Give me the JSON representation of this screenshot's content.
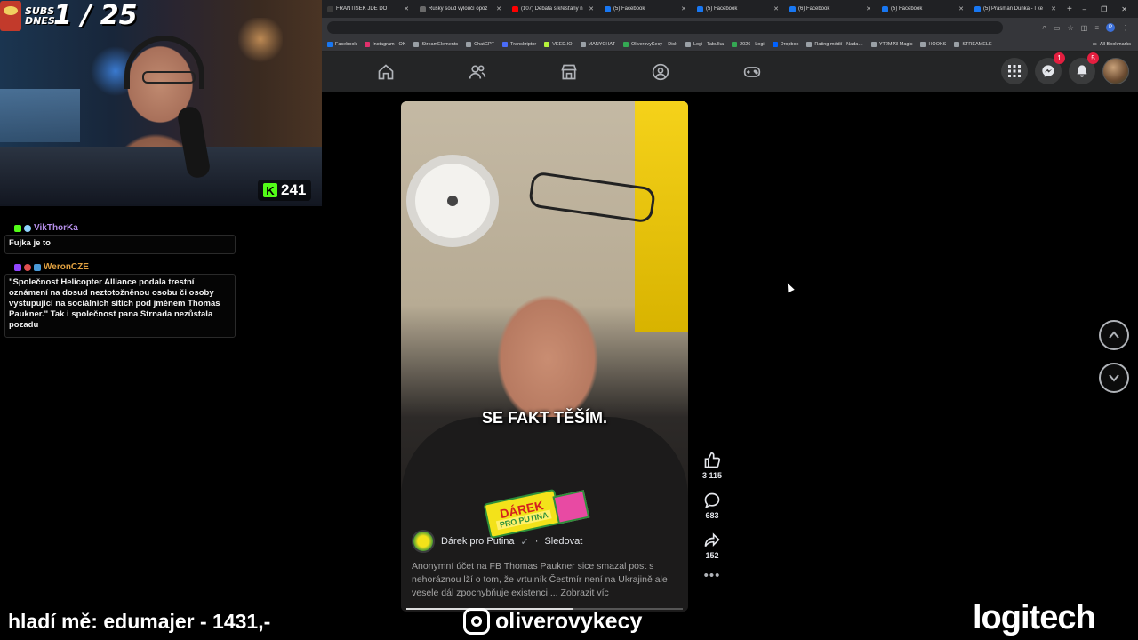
{
  "browser": {
    "tabs": [
      {
        "label": "FRANTIŠEK JDE DO",
        "color": "#3a3a3a"
      },
      {
        "label": "Ruský soud vyloučí opoz",
        "color": "#6a6a6a"
      },
      {
        "label": "(107) Debata s křesťany n",
        "color": "#ff0000"
      },
      {
        "label": "(5) Facebook",
        "color": "#1877f2"
      },
      {
        "label": "(5) Facebook",
        "color": "#1877f2"
      },
      {
        "label": "(6) Facebook",
        "color": "#1877f2"
      },
      {
        "label": "(5) Facebook",
        "color": "#1877f2"
      },
      {
        "label": "(5) Prasman Dunka - I ke",
        "color": "#1877f2"
      }
    ],
    "new_tab": "+",
    "win": {
      "min": "–",
      "max": "❐",
      "close": "✕"
    },
    "bookmarks": [
      {
        "label": "Facebook",
        "color": "#1877f2"
      },
      {
        "label": "Instagram - OK",
        "color": "#e1306c"
      },
      {
        "label": "StreamElements",
        "color": "#9aa0a6"
      },
      {
        "label": "ChatGPT",
        "color": "#9aa0a6"
      },
      {
        "label": "Transkriptor",
        "color": "#4a6cf7"
      },
      {
        "label": "VEED.IO",
        "color": "#b6f23a"
      },
      {
        "label": "MANYCHAT",
        "color": "#9aa0a6"
      },
      {
        "label": "OliverovyKecy – Disk",
        "color": "#34a853"
      },
      {
        "label": "Logi - Tabulka",
        "color": "#9aa0a6"
      },
      {
        "label": "2026 - Logi",
        "color": "#34a853"
      },
      {
        "label": "Dropbox",
        "color": "#0061ff"
      },
      {
        "label": "Rating médií - Nada…",
        "color": "#9aa0a6"
      },
      {
        "label": "YT2MP3 Magic",
        "color": "#9aa0a6"
      },
      {
        "label": "HOOKS",
        "color": "#9aa0a6"
      },
      {
        "label": "STREAMELE",
        "color": "#9aa0a6"
      }
    ],
    "all_bookmarks": "All Bookmarks",
    "profile_letter": "P"
  },
  "facebook": {
    "messenger_badge": "1",
    "notifications_badge": "5"
  },
  "overlay": {
    "subs_word": "SUBS DNES",
    "subs_count": "1 / 25",
    "kick_logo": "K",
    "kick_viewers": "241",
    "donation": "hladí mě: edumajer - 1431,-",
    "instagram_handle": "oliverovykecy",
    "sponsor": "logitech"
  },
  "chat": [
    {
      "user": "VikThorKa",
      "user_color": "#b48ee8",
      "text": "Fujka je to"
    },
    {
      "user": "WeronCZE",
      "user_color": "#e0a040",
      "text": "\"Společnost Helicopter Alliance podala trestní oznámení na dosud neztotožněnou osobu či osoby vystupující na sociálních sítích pod jménem Thomas Paukner.\" Tak i společnost pana Strnada nezůstala pozadu"
    }
  ],
  "reel": {
    "caption": "SE FAKT TĚŠÍM.",
    "sticker_line1": "DÁREK",
    "sticker_line2": "PRO PUTINA",
    "author": "Dárek pro Putina",
    "verified": "✓",
    "separator": "·",
    "follow": "Sledovat",
    "description": "Anonymní účet na FB Thomas Paukner sice smazal post s nehoráznou lží o tom, že vrtulník Čestmír není na Ukrajině ale vesele dál zpochybňuje existenci ...",
    "see_more": "Zobrazit víc",
    "progress": 0.6,
    "likes": "3 115",
    "comments": "683",
    "shares": "152",
    "more": "•••"
  }
}
